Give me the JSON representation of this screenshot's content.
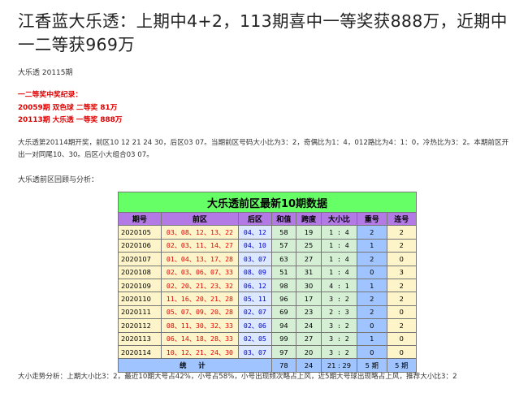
{
  "title": "江香蓝大乐透：上期中4+2，113期喜中一等奖获888万，近期中一二等获969万",
  "issue_line": "大乐透 20115期",
  "awards_heading": "一二等奖中奖纪录：",
  "awards": [
    "20059期  双色球  二等奖  81万",
    "20113期  大乐透  一等奖  888万"
  ],
  "analysis_paragraph": "大乐透第20114期开奖，前区10 12 21 24 30，后区03 07。当期前区号码大小比为3：2，奇偶比为1：4，012路比为4：1：0，冷热比为3：2。本期前区开出一对同尾10、30。后区小大组合03 07。",
  "review_heading": "大乐透前区回顾与分析：",
  "table": {
    "title": "大乐透前区最新10期数据",
    "headers": [
      "期号",
      "前区",
      "后区",
      "和值",
      "跨度",
      "大小比",
      "重号",
      "连号"
    ],
    "rows": [
      {
        "period": "2020105",
        "front": "03、08、12、13、22",
        "back": "04、12",
        "sum": "58",
        "span": "19",
        "ratio": "1 : 4",
        "repeat": "2",
        "consec": "2"
      },
      {
        "period": "2020106",
        "front": "02、03、11、14、27",
        "back": "04、10",
        "sum": "57",
        "span": "25",
        "ratio": "1 : 4",
        "repeat": "1",
        "consec": "2"
      },
      {
        "period": "2020107",
        "front": "01、04、13、17、28",
        "back": "03、07",
        "sum": "63",
        "span": "27",
        "ratio": "1 : 4",
        "repeat": "2",
        "consec": "0"
      },
      {
        "period": "2020108",
        "front": "02、03、06、07、33",
        "back": "08、09",
        "sum": "51",
        "span": "31",
        "ratio": "1 : 4",
        "repeat": "0",
        "consec": "3"
      },
      {
        "period": "2020109",
        "front": "02、20、21、23、32",
        "back": "06、12",
        "sum": "98",
        "span": "30",
        "ratio": "4 : 1",
        "repeat": "1",
        "consec": "2"
      },
      {
        "period": "2020110",
        "front": "11、16、20、21、28",
        "back": "05、11",
        "sum": "96",
        "span": "17",
        "ratio": "3 : 2",
        "repeat": "2",
        "consec": "2"
      },
      {
        "period": "2020111",
        "front": "05、07、09、20、28",
        "back": "02、07",
        "sum": "69",
        "span": "23",
        "ratio": "2 : 3",
        "repeat": "2",
        "consec": "0"
      },
      {
        "period": "2020112",
        "front": "08、11、30、32、33",
        "back": "02、06",
        "sum": "94",
        "span": "24",
        "ratio": "3 : 2",
        "repeat": "0",
        "consec": "2"
      },
      {
        "period": "2020113",
        "front": "06、14、18、28、33",
        "back": "02、05",
        "sum": "99",
        "span": "27",
        "ratio": "3 : 2",
        "repeat": "1",
        "consec": "0"
      },
      {
        "period": "2020114",
        "front": "10、12、21、24、30",
        "back": "03、07",
        "sum": "97",
        "span": "20",
        "ratio": "3 : 2",
        "repeat": "0",
        "consec": "0"
      }
    ],
    "summary": {
      "label": "统  计",
      "sum": "78",
      "span": "24",
      "ratio": "21 : 29",
      "repeat": "5 期",
      "consec": "5 期"
    }
  },
  "trend_text": "大小走势分析：上期大小比3：2，最近10期大号占42%，小号占58%，小号出现频次略占上风，近5期大号球出现略占上风，推荐大小比3：2"
}
